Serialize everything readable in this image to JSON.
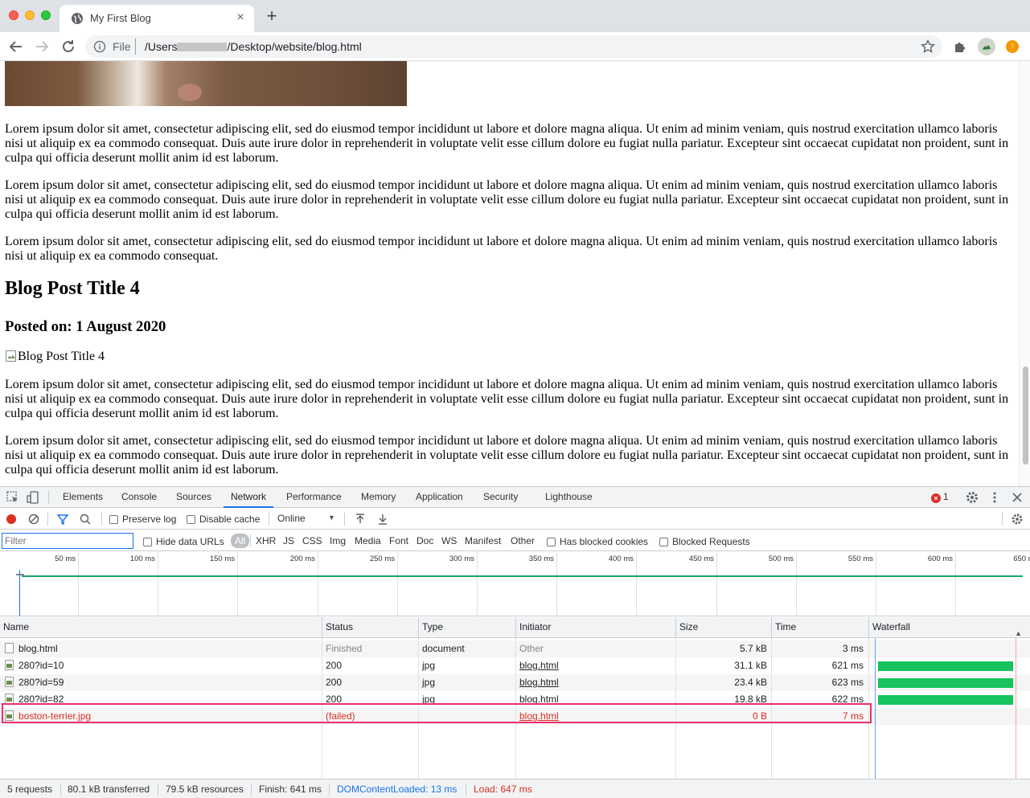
{
  "browser": {
    "tab_title": "My First Blog",
    "new_tab_label": "+",
    "url_scheme": "File",
    "url_prefix": "/Users",
    "url_suffix": "/Desktop/website/blog.html"
  },
  "page": {
    "paragraphs_before": [
      "Lorem ipsum dolor sit amet, consectetur adipiscing elit, sed do eiusmod tempor incididunt ut labore et dolore magna aliqua. Ut enim ad minim veniam, quis nostrud exercitation ullamco laboris nisi ut aliquip ex ea commodo consequat. Duis aute irure dolor in reprehenderit in voluptate velit esse cillum dolore eu fugiat nulla pariatur. Excepteur sint occaecat cupidatat non proident, sunt in culpa qui officia deserunt mollit anim id est laborum.",
      "Lorem ipsum dolor sit amet, consectetur adipiscing elit, sed do eiusmod tempor incididunt ut labore et dolore magna aliqua. Ut enim ad minim veniam, quis nostrud exercitation ullamco laboris nisi ut aliquip ex ea commodo consequat. Duis aute irure dolor in reprehenderit in voluptate velit esse cillum dolore eu fugiat nulla pariatur. Excepteur sint occaecat cupidatat non proident, sunt in culpa qui officia deserunt mollit anim id est laborum.",
      "Lorem ipsum dolor sit amet, consectetur adipiscing elit, sed do eiusmod tempor incididunt ut labore et dolore magna aliqua. Ut enim ad minim veniam, quis nostrud exercitation ullamco laboris nisi ut aliquip ex ea commodo consequat."
    ],
    "post4_title": "Blog Post Title 4",
    "post4_date": "Posted on: 1 August 2020",
    "post4_img_alt": "Blog Post Title 4",
    "paragraphs_after": [
      "Lorem ipsum dolor sit amet, consectetur adipiscing elit, sed do eiusmod tempor incididunt ut labore et dolore magna aliqua. Ut enim ad minim veniam, quis nostrud exercitation ullamco laboris nisi ut aliquip ex ea commodo consequat. Duis aute irure dolor in reprehenderit in voluptate velit esse cillum dolore eu fugiat nulla pariatur. Excepteur sint occaecat cupidatat non proident, sunt in culpa qui officia deserunt mollit anim id est laborum.",
      "Lorem ipsum dolor sit amet, consectetur adipiscing elit, sed do eiusmod tempor incididunt ut labore et dolore magna aliqua. Ut enim ad minim veniam, quis nostrud exercitation ullamco laboris nisi ut aliquip ex ea commodo consequat. Duis aute irure dolor in reprehenderit in voluptate velit esse cillum dolore eu fugiat nulla pariatur. Excepteur sint occaecat cupidatat non proident, sunt in culpa qui officia deserunt mollit anim id est laborum."
    ]
  },
  "devtools": {
    "tabs": [
      "Elements",
      "Console",
      "Sources",
      "Network",
      "Performance",
      "Memory",
      "Application",
      "Security",
      "Lighthouse"
    ],
    "active_tab": "Network",
    "error_count": "1",
    "toolbar": {
      "preserve_log": "Preserve log",
      "disable_cache": "Disable cache",
      "throttling": "Online"
    },
    "filter": {
      "placeholder": "Filter",
      "hide_data_urls": "Hide data URLs",
      "types": [
        "All",
        "XHR",
        "JS",
        "CSS",
        "Img",
        "Media",
        "Font",
        "Doc",
        "WS",
        "Manifest",
        "Other"
      ],
      "has_blocked_cookies": "Has blocked cookies",
      "blocked_requests": "Blocked Requests"
    },
    "overview_ticks": [
      "50 ms",
      "100 ms",
      "150 ms",
      "200 ms",
      "250 ms",
      "300 ms",
      "350 ms",
      "400 ms",
      "450 ms",
      "500 ms",
      "550 ms",
      "600 ms",
      "650 n"
    ],
    "columns": [
      "Name",
      "Status",
      "Type",
      "Initiator",
      "Size",
      "Time",
      "Waterfall"
    ],
    "requests": [
      {
        "name": "blog.html",
        "status": "Finished",
        "type": "document",
        "initiator": "Other",
        "size": "5.7 kB",
        "time": "3 ms",
        "icon": "document-icon",
        "failed": false,
        "wf_start_ms": 0,
        "wf_end_ms": 3
      },
      {
        "name": "280?id=10",
        "status": "200",
        "type": "jpg",
        "initiator": "blog.html",
        "size": "31.1 kB",
        "time": "621 ms",
        "icon": "image-icon",
        "failed": false,
        "wf_start_ms": 13,
        "wf_end_ms": 634
      },
      {
        "name": "280?id=59",
        "status": "200",
        "type": "jpg",
        "initiator": "blog.html",
        "size": "23.4 kB",
        "time": "623 ms",
        "icon": "image-icon",
        "failed": false,
        "wf_start_ms": 13,
        "wf_end_ms": 636
      },
      {
        "name": "280?id=82",
        "status": "200",
        "type": "jpg",
        "initiator": "blog.html",
        "size": "19.8 kB",
        "time": "622 ms",
        "icon": "image-icon",
        "failed": false,
        "wf_start_ms": 13,
        "wf_end_ms": 635
      },
      {
        "name": "boston-terrier.jpg",
        "status": "(failed)",
        "type": "",
        "initiator": "blog.html",
        "size": "0 B",
        "time": "7 ms",
        "icon": "image-icon",
        "failed": true,
        "wf_start_ms": 13,
        "wf_end_ms": 20
      }
    ],
    "status_bar": {
      "requests": "5 requests",
      "transferred": "80.1 kB transferred",
      "resources": "79.5 kB resources",
      "finish": "Finish: 641 ms",
      "dom_content_loaded": "DOMContentLoaded: 13 ms",
      "load": "Load: 647 ms"
    }
  },
  "colors": {
    "accent": "#1a73e8",
    "error": "#d93025",
    "waterfall_bar": "#16c35c",
    "highlight": "#ea2f6d"
  }
}
